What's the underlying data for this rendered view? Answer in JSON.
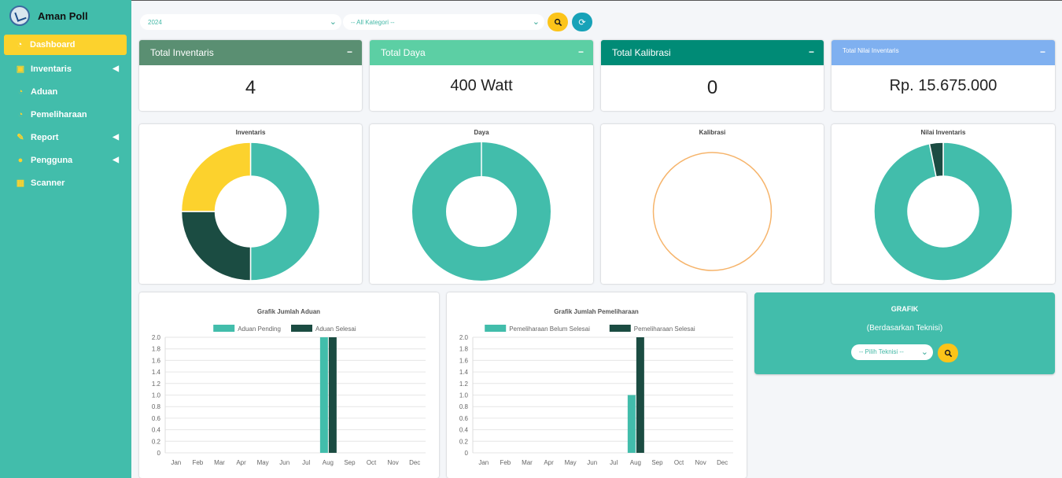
{
  "app": {
    "name": "Aman Poll"
  },
  "sidebar": {
    "items": [
      {
        "label": "Dashboard",
        "icon": "dashboard-icon",
        "active": true
      },
      {
        "label": "Inventaris",
        "icon": "copy-icon",
        "arrow": true
      },
      {
        "label": "Aduan",
        "icon": "dashboard-icon"
      },
      {
        "label": "Pemeliharaan",
        "icon": "dashboard-icon"
      },
      {
        "label": "Report",
        "icon": "edit-icon",
        "arrow": true
      },
      {
        "label": "Pengguna",
        "icon": "user-icon",
        "arrow": true
      },
      {
        "label": "Scanner",
        "icon": "grid-icon"
      }
    ]
  },
  "filters": {
    "year": "2024",
    "category": "-- All Kategori --",
    "search_icon": "search-icon",
    "refresh_icon": "refresh-icon"
  },
  "stats": [
    {
      "title": "Total Inventaris",
      "value": "4",
      "color": "#5a8f72"
    },
    {
      "title": "Total Daya",
      "value": "400 Watt",
      "color": "#5ccfa4"
    },
    {
      "title": "Total Kalibrasi",
      "value": "0",
      "color": "#008b76"
    },
    {
      "title": "Total Nilai Inventaris",
      "value": "Rp. 15.675.000",
      "color": "#7fb0f0"
    }
  ],
  "colors": {
    "teal": "#42bdab",
    "dark": "#1b4c42",
    "yellow": "#fcd22d",
    "orange": "#f6b46b"
  },
  "donuts": {
    "chart_data": [
      {
        "type": "pie",
        "title": "Inventaris",
        "values": [
          2,
          1,
          1
        ],
        "colors": [
          "#42bdab",
          "#1b4c42",
          "#fcd22d"
        ]
      },
      {
        "type": "pie",
        "title": "Daya",
        "values": [
          400
        ],
        "colors": [
          "#42bdab"
        ]
      },
      {
        "type": "pie",
        "title": "Kalibrasi",
        "values": [
          0
        ],
        "colors": [
          "#f6b46b"
        ]
      },
      {
        "type": "pie",
        "title": "Nilai Inventaris",
        "values": [
          15175000,
          500000
        ],
        "colors": [
          "#42bdab",
          "#1b4c42"
        ]
      }
    ]
  },
  "chart_data": [
    {
      "type": "bar",
      "title": "Grafik Jumlah Aduan",
      "categories": [
        "Jan",
        "Feb",
        "Mar",
        "Apr",
        "May",
        "Jun",
        "Jul",
        "Aug",
        "Sep",
        "Oct",
        "Nov",
        "Dec"
      ],
      "series": [
        {
          "name": "Aduan Pending",
          "color": "#42bdab",
          "values": [
            0,
            0,
            0,
            0,
            0,
            0,
            0,
            2,
            0,
            0,
            0,
            0
          ]
        },
        {
          "name": "Aduan Selesai",
          "color": "#1b4c42",
          "values": [
            0,
            0,
            0,
            0,
            0,
            0,
            0,
            2,
            0,
            0,
            0,
            0
          ]
        }
      ],
      "ylim": [
        0,
        2.0
      ],
      "yticks": [
        "0",
        "0.2",
        "0.4",
        "0.6",
        "0.8",
        "1.0",
        "1.2",
        "1.4",
        "1.6",
        "1.8",
        "2.0"
      ],
      "grid": true,
      "legend": "top"
    },
    {
      "type": "bar",
      "title": "Grafik Jumlah Pemeliharaan",
      "categories": [
        "Jan",
        "Feb",
        "Mar",
        "Apr",
        "May",
        "Jun",
        "Jul",
        "Aug",
        "Sep",
        "Oct",
        "Nov",
        "Dec"
      ],
      "series": [
        {
          "name": "Pemeliharaan Belum Selesai",
          "color": "#42bdab",
          "values": [
            0,
            0,
            0,
            0,
            0,
            0,
            0,
            1,
            0,
            0,
            0,
            0
          ]
        },
        {
          "name": "Pemeliharaan Selesai",
          "color": "#1b4c42",
          "values": [
            0,
            0,
            0,
            0,
            0,
            0,
            0,
            2,
            0,
            0,
            0,
            0
          ]
        }
      ],
      "ylim": [
        0,
        2.0
      ],
      "yticks": [
        "0",
        "0.2",
        "0.4",
        "0.6",
        "0.8",
        "1.0",
        "1.2",
        "1.4",
        "1.6",
        "1.8",
        "2.0"
      ],
      "grid": true,
      "legend": "top"
    }
  ],
  "grafik": {
    "title": "GRAFIK",
    "subtitle": "(Berdasarkan Teknisi)",
    "select": "-- Pilih Teknisi --"
  }
}
